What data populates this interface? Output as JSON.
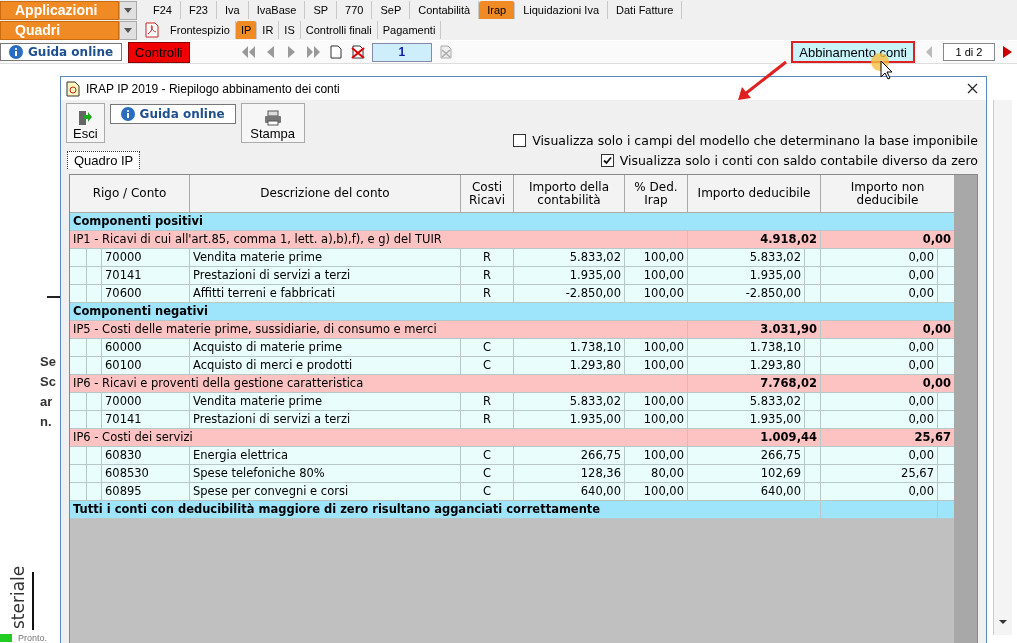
{
  "app_menu": {
    "label": "Applicazioni"
  },
  "top_tabs": [
    {
      "label": "F24",
      "selected": false
    },
    {
      "label": "F23",
      "selected": false
    },
    {
      "label": "Iva",
      "selected": false
    },
    {
      "label": "IvaBase",
      "selected": false
    },
    {
      "label": "SP",
      "selected": false
    },
    {
      "label": "770",
      "selected": false
    },
    {
      "label": "SeP",
      "selected": false
    },
    {
      "label": "Contabilità",
      "selected": false
    },
    {
      "label": "Irap",
      "selected": true
    },
    {
      "label": "Liquidazioni Iva",
      "selected": false
    },
    {
      "label": "Dati Fatture",
      "selected": false
    }
  ],
  "section_menu": {
    "label": "Quadri"
  },
  "sub_tabs": [
    {
      "label": "Frontespizio",
      "selected": false
    },
    {
      "label": "IP",
      "selected": true
    },
    {
      "label": "IR",
      "selected": false
    },
    {
      "label": "IS",
      "selected": false
    },
    {
      "label": "Controlli finali",
      "selected": false
    },
    {
      "label": "Pagamenti",
      "selected": false
    }
  ],
  "toolbar": {
    "help": "Guida online",
    "checks": "Controlli",
    "page": "1",
    "match_button": "Abbinamento conti",
    "pager": "1 di 2"
  },
  "background": {
    "lines": [
      "Se",
      "Sc",
      "ar",
      "n."
    ],
    "vertical_text": "steriale",
    "status": "Pronto."
  },
  "dialog": {
    "title": "IRAP IP 2019 - Riepilogo abbinamento dei conti",
    "exit": "Esci",
    "help": "Guida online",
    "print": "Stampa",
    "options": [
      {
        "label": "Visualizza solo i campi del modello che determinano la base imponibile",
        "checked": false
      },
      {
        "label": "Visualizza solo i conti con saldo contabile diverso da zero",
        "checked": true
      }
    ],
    "tab": "Quadro IP",
    "table": {
      "columns": [
        "Rigo / Conto",
        "Descrizione del conto",
        "Costi Ricavi",
        "Importo della contabilità",
        "% Ded. Irap",
        "Importo deducibile",
        "Importo non deducibile"
      ],
      "rows": [
        {
          "kind": "section",
          "label": "Componenti positivi"
        },
        {
          "kind": "rigo",
          "label": "IP1 - Ricavi di cui all'art.85, comma 1, lett. a),b),f), e g) del TUIR",
          "deducibile": "4.918,02",
          "non_deducibile": "0,00"
        },
        {
          "kind": "account",
          "code": "70000",
          "description": "Vendita materie prime",
          "type": "R",
          "importo": "5.833,02",
          "percent": "100,00",
          "deducibile": "5.833,02",
          "non_deducibile": "0,00"
        },
        {
          "kind": "account",
          "code": "70141",
          "description": "Prestazioni di servizi a terzi",
          "type": "R",
          "importo": "1.935,00",
          "percent": "100,00",
          "deducibile": "1.935,00",
          "non_deducibile": "0,00"
        },
        {
          "kind": "account",
          "code": "70600",
          "description": "Affitti terreni e fabbricati",
          "type": "R",
          "importo": "-2.850,00",
          "percent": "100,00",
          "deducibile": "-2.850,00",
          "non_deducibile": "0,00"
        },
        {
          "kind": "section",
          "label": "Componenti negativi"
        },
        {
          "kind": "rigo",
          "label": "IP5 - Costi delle materie prime, sussidiarie, di consumo e merci",
          "deducibile": "3.031,90",
          "non_deducibile": "0,00"
        },
        {
          "kind": "account",
          "code": "60000",
          "description": "Acquisto di materie prime",
          "type": "C",
          "importo": "1.738,10",
          "percent": "100,00",
          "deducibile": "1.738,10",
          "non_deducibile": "0,00"
        },
        {
          "kind": "account",
          "code": "60100",
          "description": "Acquisto di merci e prodotti",
          "type": "C",
          "importo": "1.293,80",
          "percent": "100,00",
          "deducibile": "1.293,80",
          "non_deducibile": "0,00"
        },
        {
          "kind": "rigo",
          "label": "IP6 - Ricavi e proventi della gestione caratteristica",
          "deducibile": "7.768,02",
          "non_deducibile": "0,00"
        },
        {
          "kind": "account",
          "code": "70000",
          "description": "Vendita materie prime",
          "type": "R",
          "importo": "5.833,02",
          "percent": "100,00",
          "deducibile": "5.833,02",
          "non_deducibile": "0,00"
        },
        {
          "kind": "account",
          "code": "70141",
          "description": "Prestazioni di servizi a terzi",
          "type": "R",
          "importo": "1.935,00",
          "percent": "100,00",
          "deducibile": "1.935,00",
          "non_deducibile": "0,00"
        },
        {
          "kind": "rigo",
          "label": "IP6 - Costi dei servizi",
          "deducibile": "1.009,44",
          "non_deducibile": "25,67"
        },
        {
          "kind": "account",
          "code": "60830",
          "description": "Energia elettrica",
          "type": "C",
          "importo": "266,75",
          "percent": "100,00",
          "deducibile": "266,75",
          "non_deducibile": "0,00"
        },
        {
          "kind": "account",
          "code": "608530",
          "description": "Spese telefoniche 80%",
          "type": "C",
          "importo": "128,36",
          "percent": "80,00",
          "deducibile": "102,69",
          "non_deducibile": "25,67"
        },
        {
          "kind": "account",
          "code": "60895",
          "description": "Spese per convegni e corsi",
          "type": "C",
          "importo": "640,00",
          "percent": "100,00",
          "deducibile": "640,00",
          "non_deducibile": "0,00"
        },
        {
          "kind": "footer",
          "label": "Tutti i conti con deducibilità maggiore di zero risultano agganciati correttamente"
        }
      ]
    }
  }
}
